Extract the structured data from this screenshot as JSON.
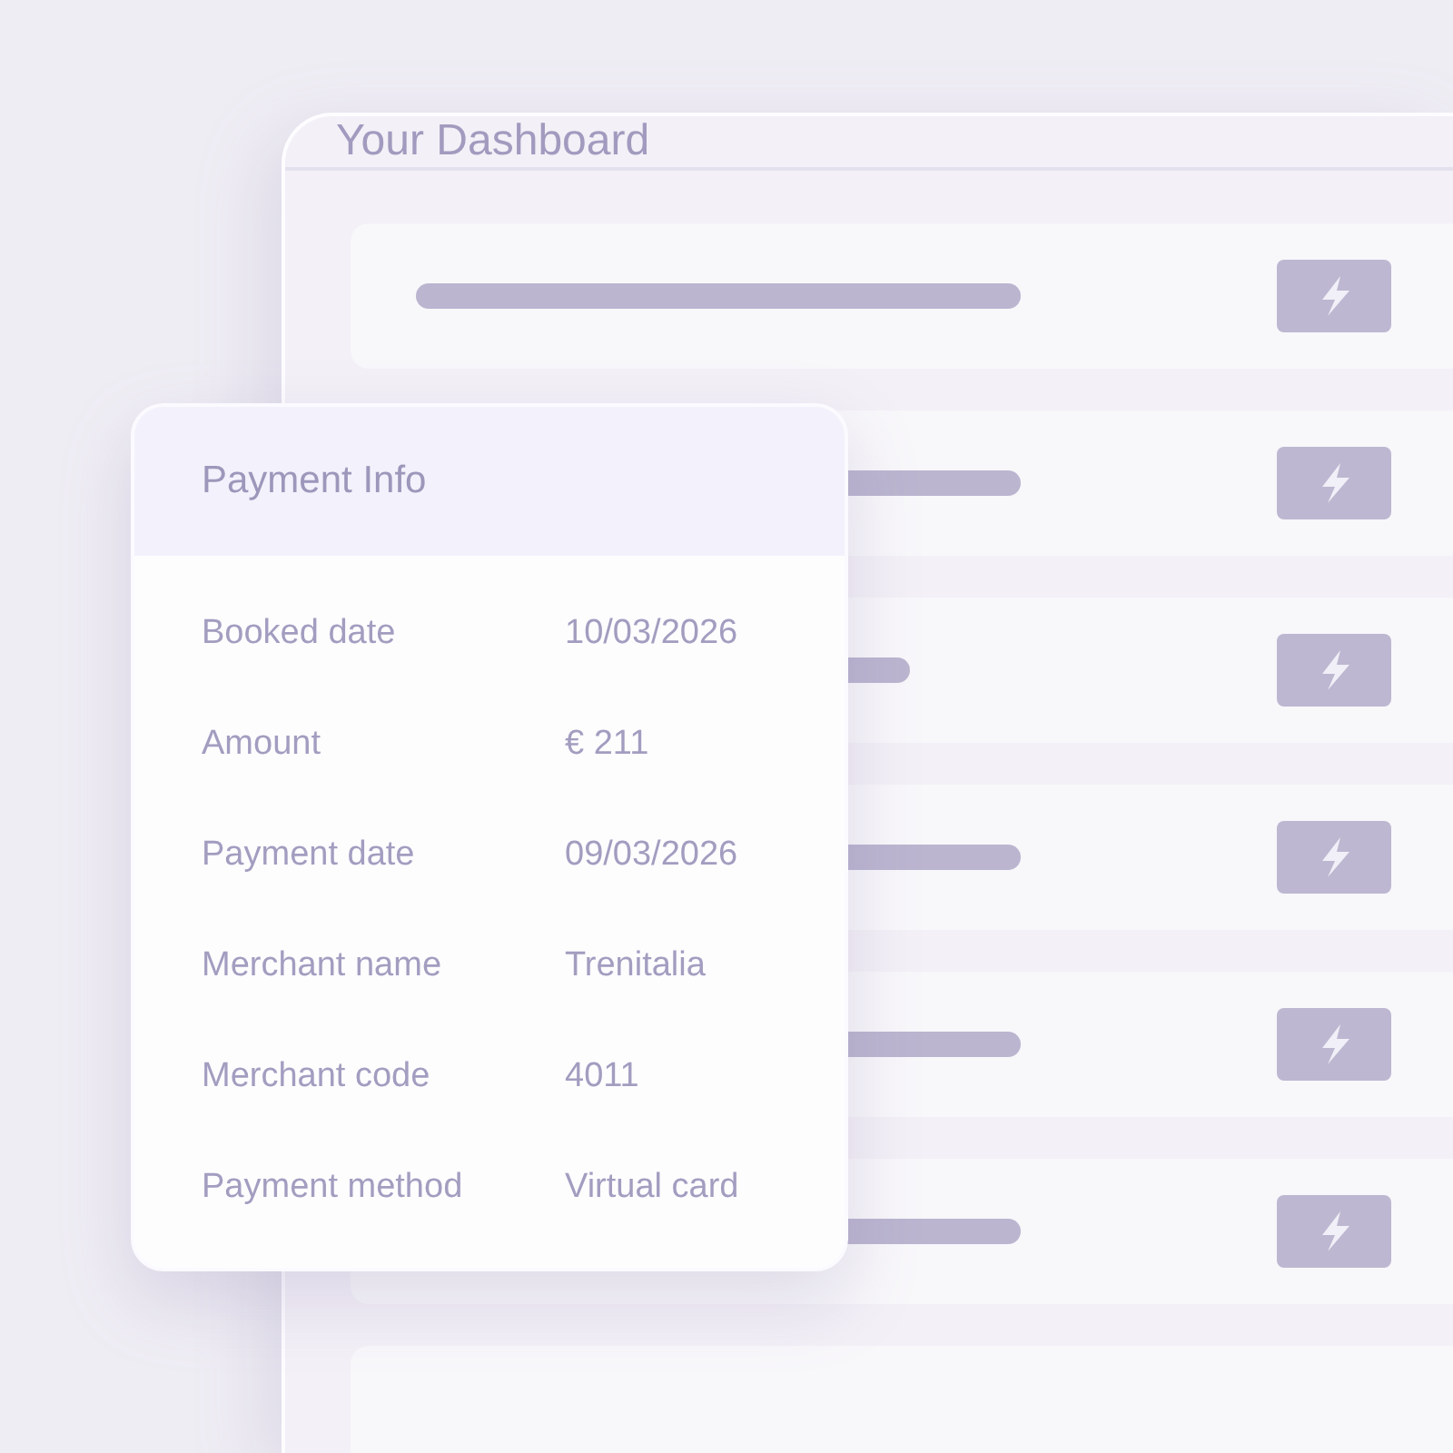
{
  "dashboard": {
    "title": "Your Dashboard",
    "rows": [
      {
        "kind": "long"
      },
      {
        "kind": "long"
      },
      {
        "kind": "short"
      },
      {
        "kind": "long"
      },
      {
        "kind": "long"
      },
      {
        "kind": "long"
      },
      {
        "kind": "blank"
      }
    ]
  },
  "payment_info": {
    "title": "Payment Info",
    "fields": [
      {
        "label": "Booked date",
        "value": "10/03/2026"
      },
      {
        "label": "Amount",
        "value": "€ 211"
      },
      {
        "label": "Payment date",
        "value": "09/03/2026"
      },
      {
        "label": "Merchant name",
        "value": "Trenitalia"
      },
      {
        "label": "Merchant code",
        "value": "4011"
      },
      {
        "label": "Payment method",
        "value": "Virtual card"
      }
    ]
  }
}
